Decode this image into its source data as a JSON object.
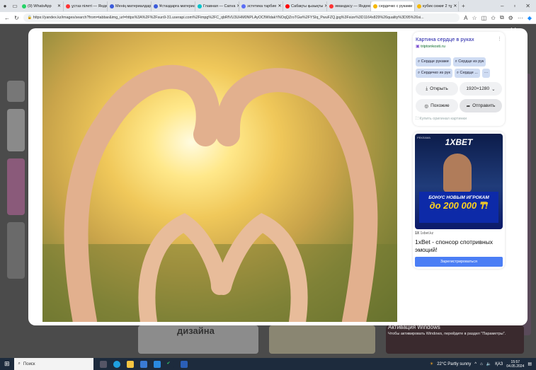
{
  "browser": {
    "tabs": [
      {
        "label": "(9) WhatsApp",
        "color": "#25d366"
      },
      {
        "label": "ұстаз пілеті — Яндекс",
        "color": "#f33"
      },
      {
        "label": "Менің материалдарым",
        "color": "#3b5bdb"
      },
      {
        "label": "Ұстаздарға материалдар",
        "color": "#3b5bdb"
      },
      {
        "label": "Главная — Canva",
        "color": "#00c4cc"
      },
      {
        "label": "эстетика тарбие",
        "color": "#5b6ef5"
      },
      {
        "label": "Сабақты қызықты",
        "color": "#f00"
      },
      {
        "label": "әмандасу — Яндекс",
        "color": "#f33"
      },
      {
        "label": "сердечко с руками",
        "color": "#f5b700",
        "active": true
      },
      {
        "label": "кубик сөжиғ 2 тұ",
        "color": "#f5b700"
      }
    ],
    "url": "https://yandex.kz/images/search?from=tabbar&img_url=https%3A%2F%2Fsun9-31.userapi.com%2Fimpg%2FC_qbRfVU3UHM0NPLAyOCfWIdakYNOqQZroTGw%2FYSIq_PwuFZQ.jpg%3Fsize%3D1164x829%26quality%3D95%26si..."
  },
  "viewer": {
    "close": "✕",
    "title": "Картина сердце в руках",
    "site": "triptonkosti.ru",
    "chips": [
      "Сердце руками",
      "Сердце из рук",
      "Сердечко из рук",
      "Сердце ...",
      "···"
    ],
    "open": "Открыть",
    "size": "1920×1280",
    "similar": "Похожие",
    "share": "Отправить",
    "buy": "Купить оригинал картинки"
  },
  "ad": {
    "label": "РЕКЛАМА",
    "logo": "1XBET",
    "line1": "БОНУС НОВЫМ ИГРОКАМ",
    "line2": "до 200 000 ₸!",
    "source": "1xbet.kz",
    "title": "1xBet - спонсор спотривных эмоций!",
    "button": "Зарегистрироваться"
  },
  "background": {
    "tile_text": "дизайна"
  },
  "watermark": {
    "title": "Активация Windows",
    "text": "Чтобы активировать Windows, перейдите в раздел \"Параметры\"."
  },
  "taskbar": {
    "search": "Поиск",
    "weather": "22°C  Partly sunny",
    "lang": "ҚАЗ",
    "time": "15:57",
    "date": "04.05.2024"
  }
}
